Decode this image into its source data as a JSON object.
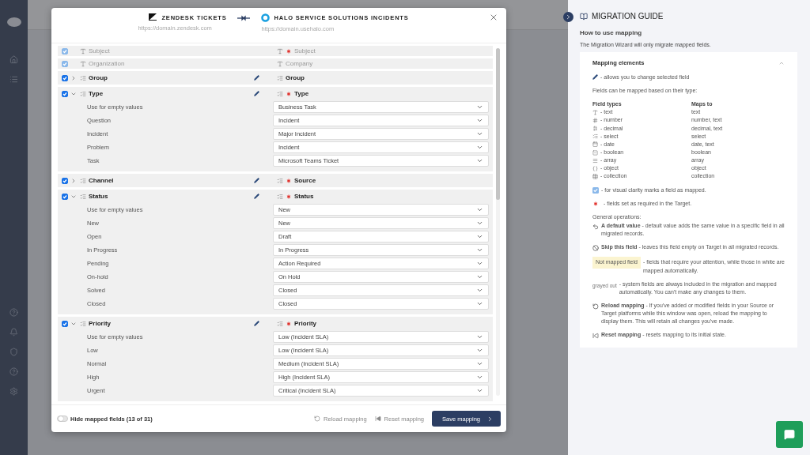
{
  "modal": {
    "source": {
      "title": "ZENDESK TICKETS",
      "url": "https://domain.zendesk.com"
    },
    "target": {
      "title": "HALO SERVICE SOLUTIONS INCIDENTS",
      "url": "https://domain.usehalo.com"
    },
    "mappings": [
      {
        "kind": "text",
        "source": "Subject",
        "target": "Subject",
        "required": true,
        "system": true,
        "checked": true
      },
      {
        "kind": "text",
        "source": "Organization",
        "target": "Company",
        "required": false,
        "system": true,
        "checked": true
      },
      {
        "kind": "select",
        "source": "Group",
        "target": "Group",
        "required": false,
        "system": false,
        "checked": true,
        "expanded": false,
        "editable": true
      },
      {
        "kind": "select",
        "source": "Type",
        "target": "Type",
        "required": true,
        "system": false,
        "checked": true,
        "expanded": true,
        "editable": true,
        "values": [
          {
            "label": "Use for empty values",
            "value": "Business Task"
          },
          {
            "label": "Question",
            "value": "Incident"
          },
          {
            "label": "Incident",
            "value": "Major Incident"
          },
          {
            "label": "Problem",
            "value": "Incident"
          },
          {
            "label": "Task",
            "value": "Microsoft Teams Ticket"
          }
        ]
      },
      {
        "kind": "select",
        "source": "Channel",
        "target": "Source",
        "required": true,
        "system": false,
        "checked": true,
        "expanded": false,
        "editable": true
      },
      {
        "kind": "select",
        "source": "Status",
        "target": "Status",
        "required": true,
        "system": false,
        "checked": true,
        "expanded": true,
        "editable": true,
        "values": [
          {
            "label": "Use for empty values",
            "value": "New"
          },
          {
            "label": "New",
            "value": "New"
          },
          {
            "label": "Open",
            "value": "Draft"
          },
          {
            "label": "In Progress",
            "value": "In Progress"
          },
          {
            "label": "Pending",
            "value": "Action Required"
          },
          {
            "label": "On-hold",
            "value": "On Hold"
          },
          {
            "label": "Solved",
            "value": "Closed"
          },
          {
            "label": "Closed",
            "value": "Closed"
          }
        ]
      },
      {
        "kind": "select",
        "source": "Priority",
        "target": "Priority",
        "required": true,
        "system": false,
        "checked": true,
        "expanded": true,
        "editable": true,
        "values": [
          {
            "label": "Use for empty values",
            "value": "Low (Incident SLA)"
          },
          {
            "label": "Low",
            "value": "Low (Incident SLA)"
          },
          {
            "label": "Normal",
            "value": "Medium (Incident SLA)"
          },
          {
            "label": "High",
            "value": "High (Incident SLA)"
          },
          {
            "label": "Urgent",
            "value": "Critical (Incident SLA)"
          }
        ]
      }
    ],
    "footer": {
      "toggle_label": "Hide mapped fields (13 of 31)",
      "toggle_on": false,
      "reload": "Reload mapping",
      "reset": "Reset mapping",
      "save": "Save mapping"
    }
  },
  "guide": {
    "title": "MIGRATION GUIDE",
    "subtitle": "How to use mapping",
    "intro": "The Migration Wizard will only migrate mapped fields.",
    "section": {
      "title": "Mapping elements",
      "expanded": true,
      "edit_note": "- allows you to change selected field",
      "types_intro": "Fields can be mapped based on their type:",
      "col_types": "Field types",
      "col_maps": "Maps to",
      "types": [
        {
          "kind": "text",
          "label": "- text",
          "maps_to": "text"
        },
        {
          "kind": "number",
          "label": "- number",
          "maps_to": "number, text"
        },
        {
          "kind": "decimal",
          "label": "- decimal",
          "maps_to": "decimal, text"
        },
        {
          "kind": "select",
          "label": "- select",
          "maps_to": "select"
        },
        {
          "kind": "date",
          "label": "- date",
          "maps_to": "date, text"
        },
        {
          "kind": "boolean",
          "label": "- boolean",
          "maps_to": "boolean"
        },
        {
          "kind": "array",
          "label": "- array",
          "maps_to": "array"
        },
        {
          "kind": "object",
          "label": "- object",
          "maps_to": "object"
        },
        {
          "kind": "collection",
          "label": "- collection",
          "maps_to": "collection"
        }
      ],
      "checkbox_note": "- for visual clarity marks a field as mapped.",
      "required_note": "- fields set as required in the Target.",
      "general_title": "General operations:",
      "operations": [
        {
          "kind": "default",
          "text": "**A default value** - default value adds the same value in a specific field in all migrated records."
        },
        {
          "kind": "skip",
          "text": "**Skip this field** - leaves this field empty on Target in all migrated records."
        },
        {
          "kind": "highlight",
          "tag": "Not mapped field",
          "text": "- fields that require your attention, while those in white are mapped automatically."
        },
        {
          "kind": "grayed",
          "tag": "grayed out",
          "text": "- system fields are always included in the migration and mapped automatically. You can't make any changes to them."
        },
        {
          "kind": "reload",
          "text": "**Reload mapping** - If you've added or modified fields in your Source or Target platforms while this window was open, reload the mapping to display them. This will retain all changes you've made."
        },
        {
          "kind": "reset",
          "text": "**Reset mapping** - resets mapping to its initial state."
        }
      ]
    }
  }
}
